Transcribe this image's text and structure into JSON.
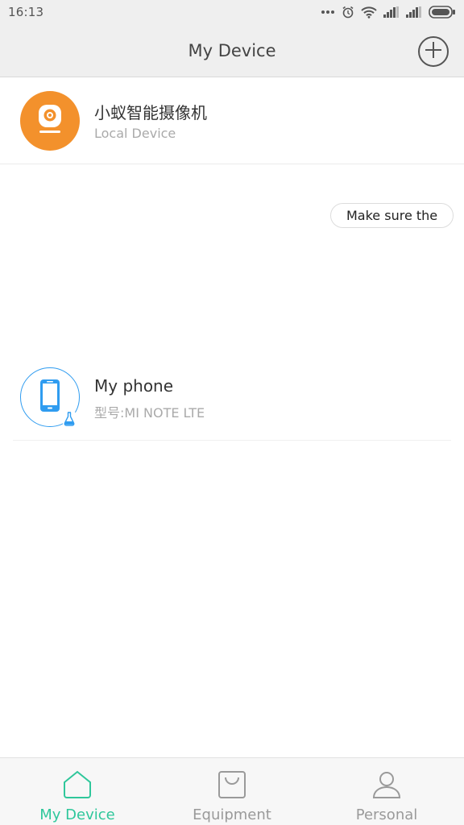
{
  "status_bar": {
    "time": "16:13",
    "icons": [
      "more-dots-icon",
      "alarm-icon",
      "wifi-icon",
      "signal-icon",
      "signal-icon-2",
      "battery-icon"
    ]
  },
  "header": {
    "title": "My Device",
    "add_icon": "plus-circle-icon"
  },
  "devices": [
    {
      "name": "小蚁智能摄像机",
      "subtitle": "Local Device",
      "icon": "camera-icon",
      "avatar_color": "#f3912c"
    },
    {
      "name": "My phone",
      "subtitle": "型号:MI NOTE LTE",
      "icon": "phone-icon",
      "badge_icon": "flask-icon",
      "avatar_color": "#2f9cf0"
    }
  ],
  "hint": {
    "text": "Make sure the"
  },
  "bottom_nav": {
    "items": [
      {
        "label": "My Device",
        "icon": "home-icon",
        "active": true
      },
      {
        "label": "Equipment",
        "icon": "shopping-bag-icon",
        "active": false
      },
      {
        "label": "Personal",
        "icon": "user-icon",
        "active": false
      }
    ],
    "active_color": "#2fc79b",
    "inactive_color": "#9a9a9a"
  }
}
